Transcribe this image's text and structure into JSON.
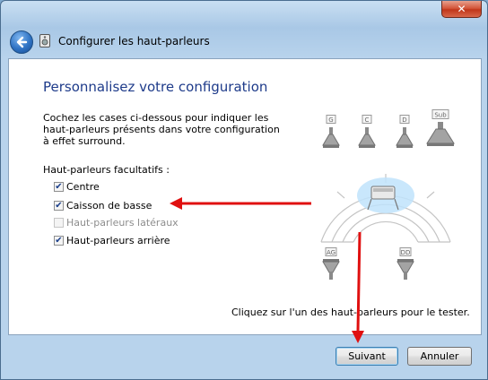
{
  "window": {
    "title": "Configurer les haut-parleurs",
    "close_symbol": "✕"
  },
  "page": {
    "heading": "Personnalisez votre configuration",
    "instructions": "Cochez les cases ci-dessous pour indiquer les\nhaut-parleurs présents dans votre configuration\nà effet surround.",
    "optional_label": "Haut-parleurs facultatifs :",
    "options": [
      {
        "label": "Centre",
        "checked": true,
        "enabled": true
      },
      {
        "label": "Caisson de basse",
        "checked": true,
        "enabled": true
      },
      {
        "label": "Haut-parleurs latéraux",
        "checked": false,
        "enabled": false
      },
      {
        "label": "Haut-parleurs arrière",
        "checked": true,
        "enabled": true
      }
    ],
    "hint": "Cliquez sur l'un des haut-parleurs pour le tester."
  },
  "speakers": {
    "left": "G",
    "center": "C",
    "right": "D",
    "sub": "Sub",
    "rear_left": "AG",
    "rear_right": "DD"
  },
  "buttons": {
    "next": "Suivant",
    "cancel": "Annuler"
  },
  "colors": {
    "heading": "#1e3b8a",
    "annotation_arrow": "#e01010",
    "listening_zone": "#bfe3fb"
  },
  "icons": {
    "back": "back-arrow-icon",
    "close": "close-icon",
    "speaker": "speaker-icon",
    "subwoofer": "subwoofer-icon"
  }
}
